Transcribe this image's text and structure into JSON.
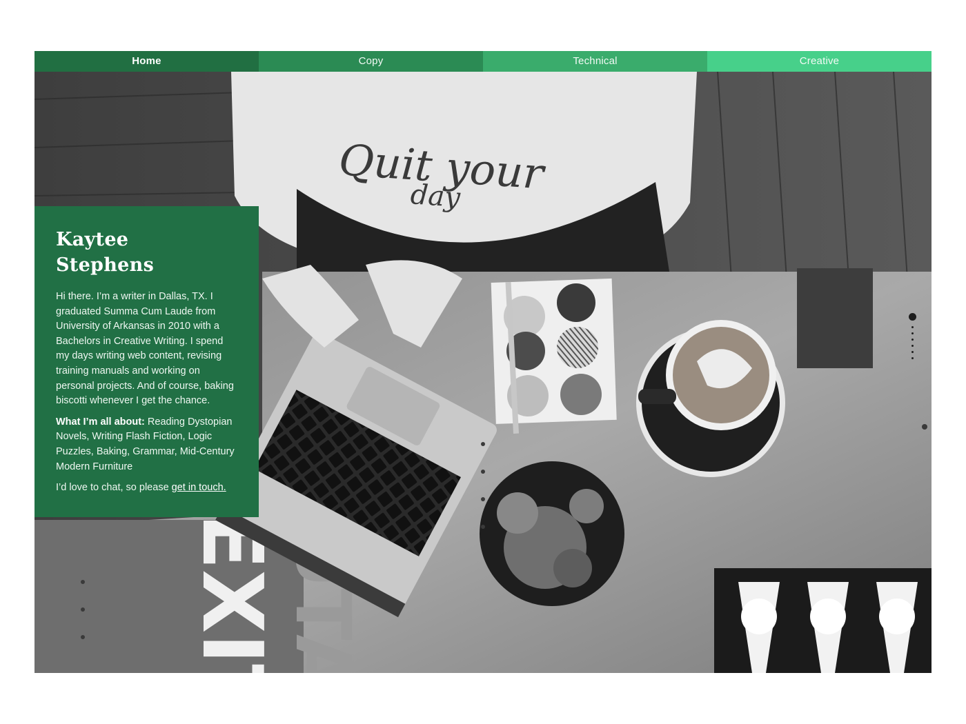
{
  "nav": {
    "tabs": [
      {
        "label": "Home",
        "color": "#216f42",
        "active": true
      },
      {
        "label": "Copy",
        "color": "#2b8b54",
        "active": false
      },
      {
        "label": "Technical",
        "color": "#3aac6c",
        "active": false
      },
      {
        "label": "Creative",
        "color": "#47d08a",
        "active": false
      }
    ]
  },
  "hero": {
    "shirt_text": "Quit your",
    "shirt_text_2": "day",
    "sign_text": "EXIT",
    "sign_text_2": "UTA"
  },
  "intro": {
    "name_line1": "Kaytee",
    "name_line2": "Stephens",
    "bio": "Hi there. I’m a writer in Dallas, TX. I graduated Summa Cum Laude from University of Arkansas in 2010 with a Bachelors in Creative Writing. I spend my days writing web content, revising training manuals and working on personal projects. And of course, baking biscotti whenever I get the chance.",
    "interests_label": "What I’m all about:",
    "interests_text": "Reading Dystopian Novels, Writing Flash Fiction, Logic Puzzles, Baking, Grammar, Mid-Century Modern Furniture",
    "contact_text": "I’d love to chat, so please",
    "contact_link": "get in touch.",
    "card_color": "#217045"
  },
  "slider": {
    "dot_count": 7,
    "active_index": 0
  }
}
